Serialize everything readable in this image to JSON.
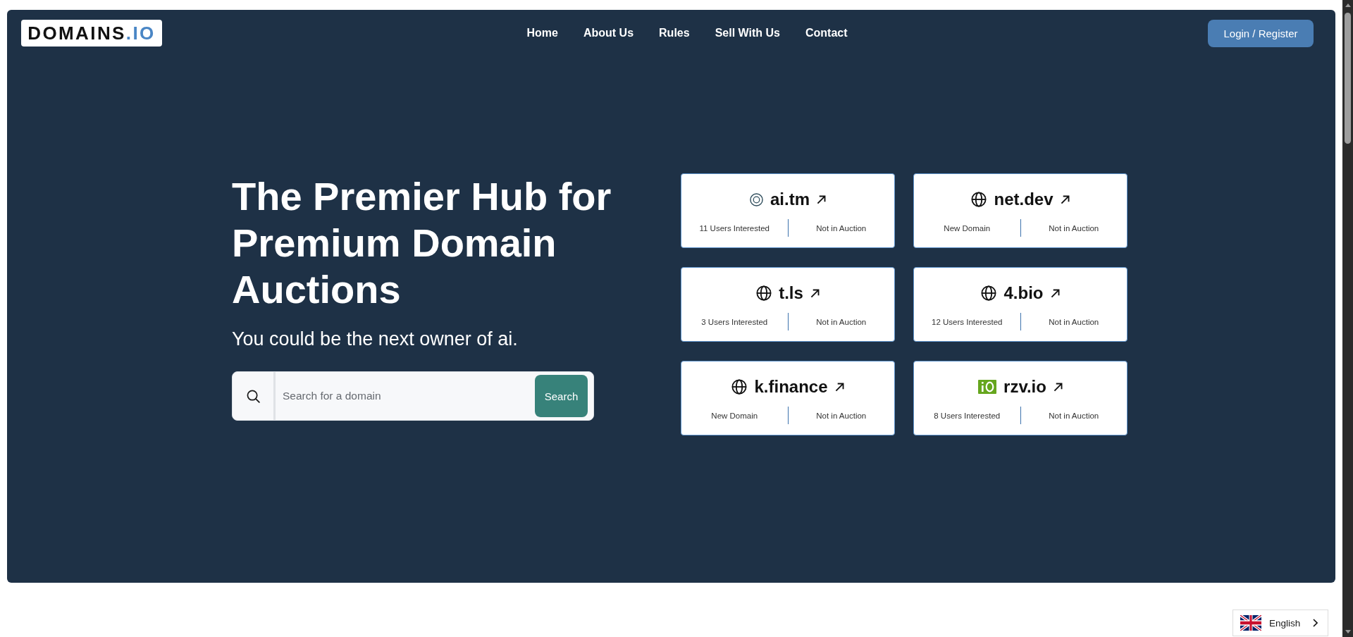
{
  "logo": {
    "name": "DOMAINS",
    "suffix": ".IO"
  },
  "nav": [
    {
      "label": "Home"
    },
    {
      "label": "About Us"
    },
    {
      "label": "Rules"
    },
    {
      "label": "Sell With Us"
    },
    {
      "label": "Contact"
    }
  ],
  "login_button": {
    "label": "Login / Register"
  },
  "hero": {
    "title": "The Premier Hub for Premium Domain Auctions",
    "subtitle": "You could be the next owner of ai."
  },
  "search": {
    "placeholder": "Search for a domain",
    "button": "Search"
  },
  "domains": [
    {
      "kind": "ring",
      "name": "ai.tm",
      "info": "11 Users Interested",
      "auction": "Not in Auction"
    },
    {
      "kind": "globe",
      "name": "net.dev",
      "info": "New Domain",
      "auction": "Not in Auction"
    },
    {
      "kind": "globe",
      "name": "t.ls",
      "info": "3 Users Interested",
      "auction": "Not in Auction"
    },
    {
      "kind": "globe",
      "name": "4.bio",
      "info": "12 Users Interested",
      "auction": "Not in Auction"
    },
    {
      "kind": "globe",
      "name": "k.finance",
      "info": "New Domain",
      "auction": "Not in Auction"
    },
    {
      "kind": "tile",
      "name": "rzv.io",
      "info": "8 Users Interested",
      "auction": "Not in Auction"
    }
  ],
  "language": {
    "label": "English"
  }
}
